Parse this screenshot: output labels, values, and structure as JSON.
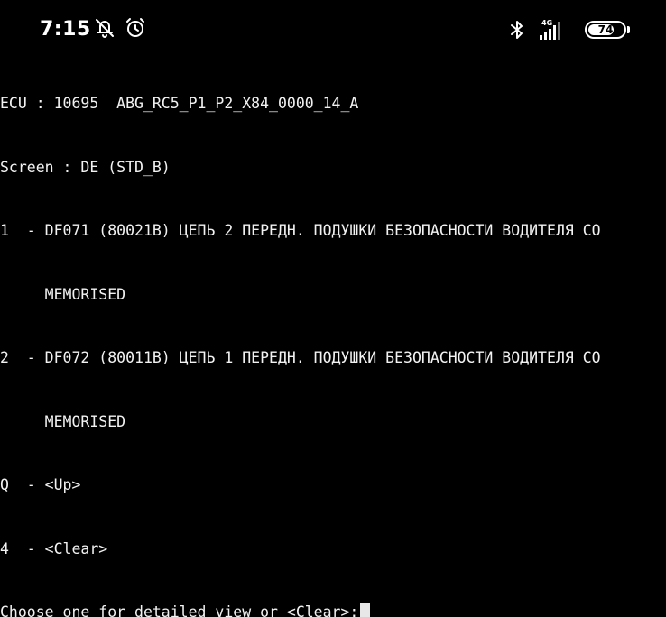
{
  "status_bar": {
    "time": "7:15",
    "icons": [
      "bell-off-icon",
      "alarm-clock-icon",
      "bluetooth-icon",
      "signal-4g-icon",
      "battery-icon"
    ],
    "network_label": "4G",
    "battery_level": "74",
    "battery_fraction": 0.74
  },
  "terminal": {
    "lines": [
      "ECU : 10695  ABG_RC5_P1_P2_X84_0000_14_A",
      "Screen : DE (STD_B)",
      "1  - DF071 (80021B) ЦЕПЬ 2 ПЕРЕДН. ПОДУШКИ БЕЗОПАСНОСТИ ВОДИТЕЛЯ СО",
      "     MEMORISED",
      "2  - DF072 (80011B) ЦЕПЬ 1 ПЕРЕДН. ПОДУШКИ БЕЗОПАСНОСТИ ВОДИТЕЛЯ СО",
      "     MEMORISED",
      "Q  - <Up>",
      "4  - <Clear>",
      "Choose one for detailed view or <Clear>:"
    ]
  }
}
